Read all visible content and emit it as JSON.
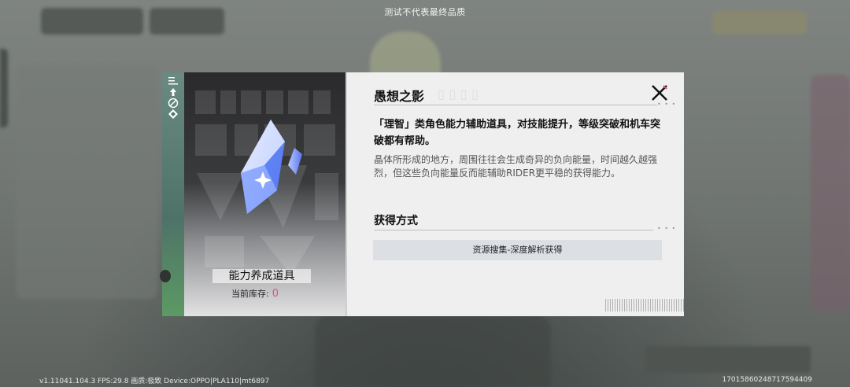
{
  "watermark": "测试不代表最终品质",
  "build_info": "v1.11041.104.3 FPS:29.8 画质:极致 Device:OPPO|PLA110|mt6897",
  "uid": "17015860248717594409",
  "item": {
    "name": "能力养成道具",
    "stock_label": "当前库存:",
    "stock_value": "0",
    "icon": "blue-crystal-icon"
  },
  "detail": {
    "title": "愚想之影",
    "description": "「理智」类角色能力辅助道具，对技能提升，等级突破和机车突破都有帮助。",
    "lore": "晶体所形成的地方，周围往往会生成奇异的负向能量，时间越久越强烈，但这些负向能量反而能辅助RIDER更平稳的获得能力。",
    "acquire_title": "获得方式",
    "acquire_source": "资源搜集-深度解析获得"
  },
  "colors": {
    "accent_green": "#5c9a63",
    "stock_pink": "#e0507a",
    "crystal_blue": "#7fa3ff"
  }
}
